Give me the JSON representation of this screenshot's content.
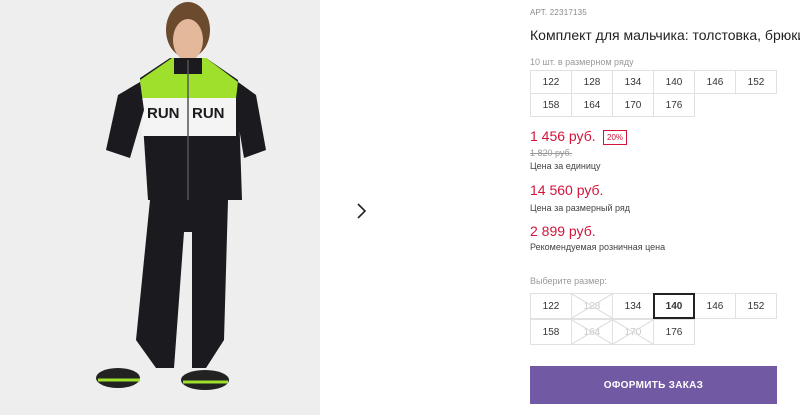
{
  "product": {
    "article": "АРТ. 22317135",
    "title": "Комплект для мальчика: толстовка, брюки",
    "size_range_caption": "10 шт. в размерном ряду",
    "size_range": [
      "122",
      "128",
      "134",
      "140",
      "146",
      "152",
      "158",
      "164",
      "170",
      "176"
    ]
  },
  "pricing": {
    "unit_price": "1 456 руб.",
    "discount": "20%",
    "old_price": "1 820 руб.",
    "unit_caption": "Цена за единицу",
    "row_price": "14 560 руб.",
    "row_caption": "Цена за размерный ряд",
    "retail_price": "2 899 руб.",
    "retail_caption": "Рекомендуемая розничная цена"
  },
  "size_picker": {
    "caption": "Выберите размер:",
    "options": [
      {
        "label": "122",
        "available": true
      },
      {
        "label": "128",
        "available": false
      },
      {
        "label": "134",
        "available": true
      },
      {
        "label": "140",
        "available": true,
        "selected": true
      },
      {
        "label": "146",
        "available": true
      },
      {
        "label": "152",
        "available": true
      },
      {
        "label": "158",
        "available": true
      },
      {
        "label": "164",
        "available": false
      },
      {
        "label": "170",
        "available": false
      },
      {
        "label": "176",
        "available": true
      }
    ]
  },
  "actions": {
    "order_label": "ОФОРМИТЬ ЗАКАЗ"
  },
  "gallery": {
    "next_icon": "chevron-right-icon"
  },
  "colors": {
    "accent": "#7159a3",
    "price": "#d2143a",
    "lime": "#a6e22e"
  }
}
